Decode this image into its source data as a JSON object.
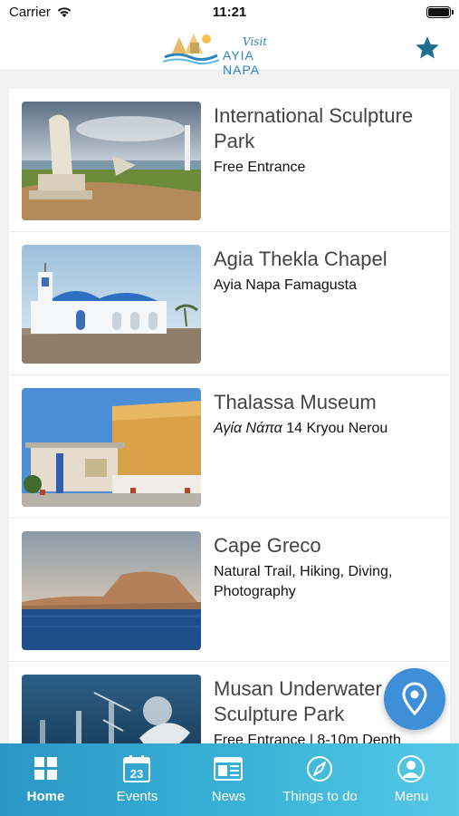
{
  "status": {
    "carrier": "Carrier",
    "time": "11:21"
  },
  "header": {
    "logo_visit": "Visit",
    "logo_brand": "AYIA NAPA",
    "accent": "#1f6f92"
  },
  "places": [
    {
      "title": "International Sculpture Park",
      "title_line1": "International Sculpture",
      "title_line2": "Park",
      "subtitle": "Free Entrance"
    },
    {
      "title": "Agia Thekla Chapel",
      "subtitle": "Ayia Napa Famagusta"
    },
    {
      "title": "Thalassa Museum",
      "subtitle_prefix": "Αγία Νάπα",
      "subtitle": "14 Kryou Nerou"
    },
    {
      "title": "Cape Greco",
      "subtitle_line1": "Natural Trail, Hiking, Diving,",
      "subtitle_line2": "Photography"
    },
    {
      "title_line1": "Musan Underwater",
      "title_line2": "Sculpture Park",
      "subtitle": "Free Entrance | 8-10m Depth"
    }
  ],
  "fab": {
    "icon": "map-pin-icon"
  },
  "tabs": [
    {
      "label": "Home",
      "icon": "grid-icon",
      "active": true
    },
    {
      "label": "Events",
      "icon": "calendar-icon",
      "day": "23"
    },
    {
      "label": "News",
      "icon": "newspaper-icon"
    },
    {
      "label": "Things to do",
      "icon": "compass-icon"
    },
    {
      "label": "Menu",
      "icon": "user-icon"
    }
  ]
}
